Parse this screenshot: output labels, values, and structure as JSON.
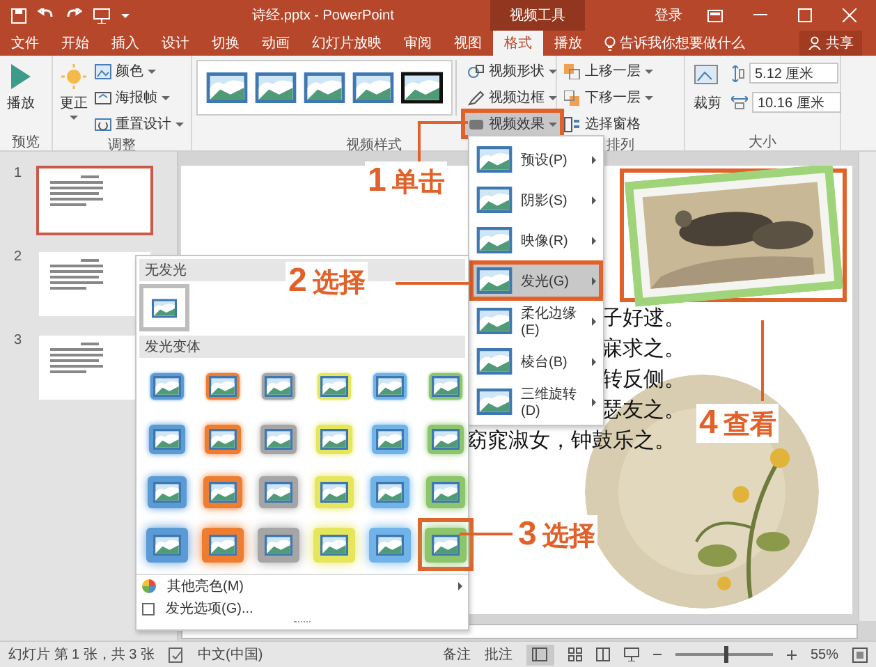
{
  "title_bar": {
    "file_title": "诗经.pptx - PowerPoint",
    "context_group": "视频工具",
    "sign_in": "登录"
  },
  "tabs": [
    {
      "label": "文件",
      "selected": false
    },
    {
      "label": "开始",
      "selected": false
    },
    {
      "label": "插入",
      "selected": false
    },
    {
      "label": "设计",
      "selected": false
    },
    {
      "label": "切换",
      "selected": false
    },
    {
      "label": "动画",
      "selected": false
    },
    {
      "label": "幻灯片放映",
      "selected": false
    },
    {
      "label": "审阅",
      "selected": false
    },
    {
      "label": "视图",
      "selected": false
    },
    {
      "label": "格式",
      "selected": true
    },
    {
      "label": "播放",
      "selected": false
    }
  ],
  "tell_me": "告诉我你想要做什么",
  "share": "共享",
  "ribbon": {
    "preview": {
      "label": "预览",
      "play": "播放"
    },
    "adjust": {
      "label": "调整",
      "correct": "更正",
      "color_button": "颜色",
      "poster_frame": "海报帧",
      "reset": "重置设计"
    },
    "video_styles": {
      "label": "视频样式",
      "styles": [
        {
          "kind": "light"
        },
        {
          "kind": "light"
        },
        {
          "kind": "light"
        },
        {
          "kind": "light"
        },
        {
          "kind": "dark"
        }
      ],
      "video_shape": "视频形状",
      "video_border": "视频边框",
      "video_effects": {
        "label": "视频效果",
        "highlighted": true
      }
    },
    "arrange": {
      "label": "排列",
      "bring_forward": "上移一层",
      "send_backward": "下移一层",
      "selection_pane": "选择窗格"
    },
    "size": {
      "label": "大小",
      "crop": "裁剪",
      "height": "5.12 厘米",
      "width": "10.16 厘米"
    }
  },
  "slides": [
    {
      "number": "1",
      "selected": true
    },
    {
      "number": "2",
      "selected": false
    },
    {
      "number": "3",
      "selected": false
    }
  ],
  "slide": {
    "text_lines": [
      "子好逑。",
      "寐求之。",
      "转反侧。",
      "瑟友之。",
      "窈窕淑女，钟鼓乐之。"
    ],
    "photo": {
      "kind": "picture",
      "highlighted": true
    },
    "round_picture": {
      "kind": "picture"
    }
  },
  "effects_menu": [
    {
      "label": "预设(P)",
      "selected": false,
      "highlighted": false
    },
    {
      "label": "阴影(S)",
      "selected": false,
      "highlighted": false
    },
    {
      "label": "映像(R)",
      "selected": false,
      "highlighted": false
    },
    {
      "label": "发光(G)",
      "selected": true,
      "highlighted": true
    },
    {
      "label": "柔化边缘(E)",
      "selected": false,
      "highlighted": false
    },
    {
      "label": "棱台(B)",
      "selected": false,
      "highlighted": false
    },
    {
      "label": "三维旋转(D)",
      "selected": false,
      "highlighted": false
    }
  ],
  "glow_gallery": {
    "no_glow_header": "无发光",
    "no_glow": {
      "selected": true
    },
    "variants_header": "发光变体",
    "variants": [
      {
        "color": "#5b9bd5",
        "highlighted": false
      },
      {
        "color": "#ed7d31",
        "highlighted": false
      },
      {
        "color": "#a5a5a5",
        "highlighted": false
      },
      {
        "color": "#e6e65c",
        "highlighted": false
      },
      {
        "color": "#6fb3e8",
        "highlighted": false
      },
      {
        "color": "#8cc56a",
        "highlighted": false
      },
      {
        "color": "#5b9bd5",
        "highlighted": false
      },
      {
        "color": "#ed7d31",
        "highlighted": false
      },
      {
        "color": "#a5a5a5",
        "highlighted": false
      },
      {
        "color": "#e6e65c",
        "highlighted": false
      },
      {
        "color": "#6fb3e8",
        "highlighted": false
      },
      {
        "color": "#8cc56a",
        "highlighted": false
      },
      {
        "color": "#5b9bd5",
        "highlighted": false
      },
      {
        "color": "#ed7d31",
        "highlighted": false
      },
      {
        "color": "#a5a5a5",
        "highlighted": false
      },
      {
        "color": "#e6e65c",
        "highlighted": false
      },
      {
        "color": "#6fb3e8",
        "highlighted": false
      },
      {
        "color": "#8cc56a",
        "highlighted": false
      },
      {
        "color": "#5b9bd5",
        "highlighted": false
      },
      {
        "color": "#ed7d31",
        "highlighted": false
      },
      {
        "color": "#a5a5a5",
        "highlighted": false
      },
      {
        "color": "#e6e65c",
        "highlighted": false
      },
      {
        "color": "#6fb3e8",
        "highlighted": false
      },
      {
        "color": "#8cc56a",
        "highlighted": true
      }
    ],
    "more_colors": "其他亮色(M)",
    "options": "发光选项(G)..."
  },
  "annotations": [
    {
      "number": "1",
      "text": "单击"
    },
    {
      "number": "2",
      "text": "选择"
    },
    {
      "number": "3",
      "text": "选择"
    },
    {
      "number": "4",
      "text": "查看"
    }
  ],
  "status_bar": {
    "slide_info": "幻灯片 第 1 张，共 3 张",
    "language": "中文(中国)",
    "notes": "备注",
    "comments": "批注",
    "zoom_slider": {
      "level": 0.5
    },
    "zoom": "55%"
  }
}
